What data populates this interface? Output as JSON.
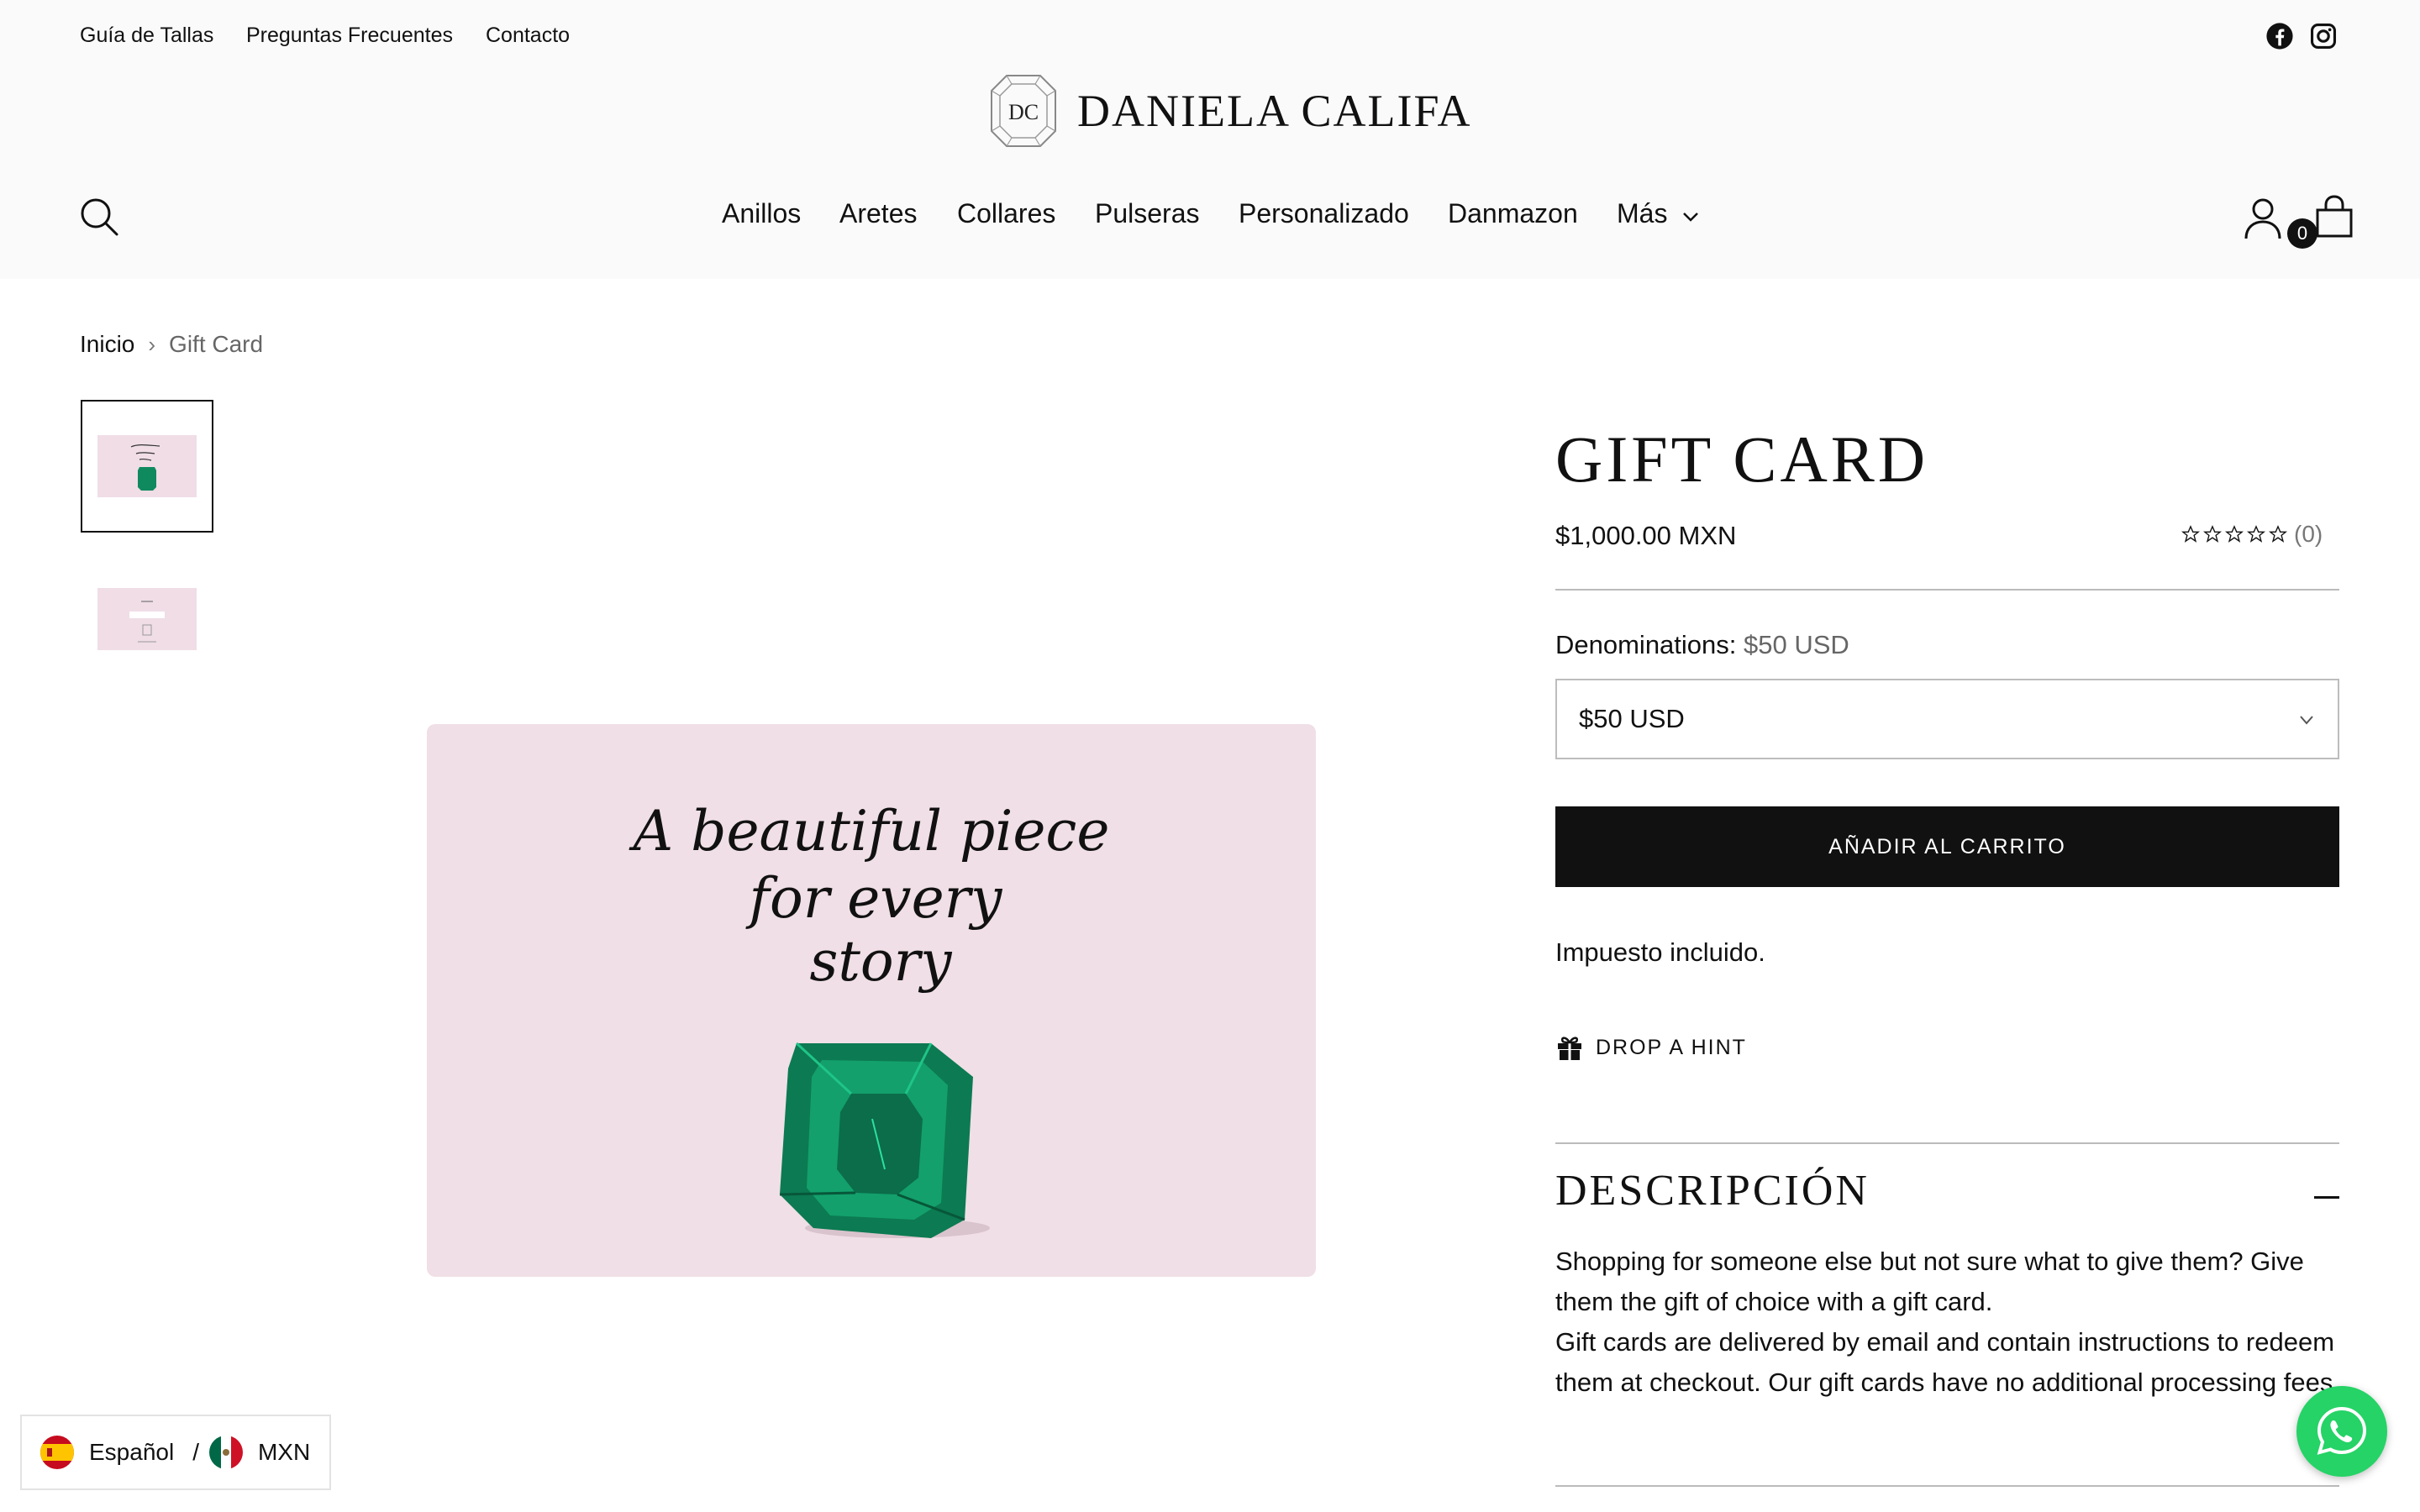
{
  "utility_nav": [
    "Guía de Tallas",
    "Preguntas Frecuentes",
    "Contacto"
  ],
  "social": {
    "facebook_icon": "facebook-icon",
    "instagram_icon": "instagram-icon"
  },
  "logo": {
    "text": "DANIELA CALIFA",
    "emblem_letters": "DC"
  },
  "main_nav": [
    "Anillos",
    "Aretes",
    "Collares",
    "Pulseras",
    "Personalizado",
    "Danmazon",
    "Más"
  ],
  "cart": {
    "count": "0"
  },
  "breadcrumb": {
    "home": "Inicio",
    "separator": "›",
    "current": "Gift Card"
  },
  "product": {
    "title": "GIFT CARD",
    "price": "$1,000.00 MXN",
    "rating_count": "(0)",
    "rating_stars": 0,
    "option_label": "Denominations:",
    "option_value": "$50 USD",
    "selected_option": "$50 USD",
    "add_to_cart": "AÑADIR AL CARRITO",
    "tax_note": "Impuesto incluido.",
    "drop_hint": "DROP A HINT"
  },
  "image_text": {
    "line1": "A beautiful piece",
    "line2": "for every",
    "line3": "story"
  },
  "description": {
    "title": "DESCRIPCIÓN",
    "paragraph1": "Shopping for someone else but not sure what to give them? Give them the gift of choice with a gift card.",
    "paragraph2": "Gift cards are delivered by email and contain instructions to redeem them at checkout. Our gift cards have no additional processing fees."
  },
  "locale": {
    "language": "Español",
    "separator": "/",
    "currency": "MXN"
  },
  "colors": {
    "accent": "#111111",
    "card_pink": "#f0dfe6",
    "emerald": "#0f8a5f",
    "whatsapp": "#25d366"
  }
}
